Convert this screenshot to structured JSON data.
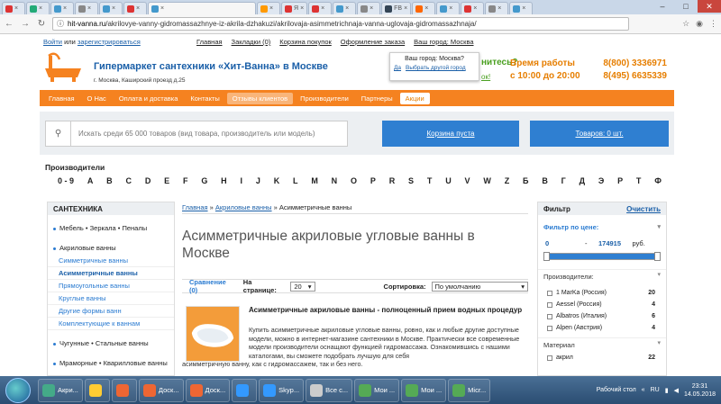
{
  "browser": {
    "tabs": [
      {
        "label": "",
        "color": "#d33"
      },
      {
        "label": "",
        "color": "#2a7"
      },
      {
        "label": "",
        "color": "#49c"
      },
      {
        "label": "",
        "color": "#888"
      },
      {
        "label": "",
        "color": "#49c"
      },
      {
        "label": "",
        "color": "#d33"
      },
      {
        "label": "",
        "color": "#49c"
      },
      {
        "label": "",
        "color": "#f90"
      },
      {
        "label": "Я",
        "color": "#d33"
      },
      {
        "label": "",
        "color": "#d33"
      },
      {
        "label": "",
        "color": "#49c"
      },
      {
        "label": "",
        "color": "#888"
      },
      {
        "label": "FB",
        "color": "#345"
      },
      {
        "label": "",
        "color": "#f60"
      },
      {
        "label": "",
        "color": "#49c"
      },
      {
        "label": "",
        "color": "#d33"
      },
      {
        "label": "",
        "color": "#888"
      },
      {
        "label": "",
        "color": "#49c"
      }
    ],
    "url_host": "hit-vanna.ru",
    "url_path": "/akrilovye-vanny-gidromassazhnye-iz-akrila-dzhakuzi/akrilovaja-asimmetrichnaja-vanna-uglovaja-gidromassazhnaja/"
  },
  "topline": {
    "login": "Войти",
    "or": " или ",
    "register": "зарегистрироваться",
    "links": [
      "Главная",
      "Закладки (0)",
      "Корзина покупок",
      "Оформление заказа",
      "Ваш город: Москва"
    ]
  },
  "header": {
    "site_name": "Гипермаркет сантехники «Хит-Ванна» в Москве",
    "address": "г. Москва, Каширский проезд д.25",
    "city_question": "Ваш город: Москва?",
    "city_yes": "Да",
    "city_other": "Выбрать другой город",
    "green_frag1": "нитесь?",
    "green_frag2": "ок!",
    "hours_title": "Время работы",
    "hours_value": "с 10:00 до 20:00",
    "phone1": "8(800) 3336971",
    "phone2": "8(495) 6635339"
  },
  "nav": [
    "Главная",
    "О Нас",
    "Оплата и доставка",
    "Контакты",
    "Отзывы клиентов",
    "Производители",
    "Партнеры",
    "Акции"
  ],
  "search": {
    "placeholder": "Искать среди 65 000 товаров (вид товара, производитель или модель)",
    "cart": "Корзина пуста",
    "goods": "Товаров: 0 шт."
  },
  "manufacturers_title": "Производители",
  "alphabet": [
    "0 - 9",
    "A",
    "B",
    "C",
    "D",
    "E",
    "F",
    "G",
    "H",
    "I",
    "J",
    "K",
    "L",
    "M",
    "N",
    "O",
    "P",
    "R",
    "S",
    "T",
    "U",
    "V",
    "W",
    "Z",
    "Б",
    "В",
    "Г",
    "Д",
    "Э",
    "Р",
    "Т",
    "Ф"
  ],
  "sidebar": {
    "title": "САНТЕХНИКА",
    "items": [
      {
        "label": "Мебель • Зеркала • Пеналы",
        "type": "top"
      },
      {
        "label": "Акриловые ванны",
        "type": "top"
      },
      {
        "label": "Симметричные ванны",
        "type": "sub"
      },
      {
        "label": "Асимметричные ванны",
        "type": "sub-active"
      },
      {
        "label": "Прямоугольные ванны",
        "type": "sub"
      },
      {
        "label": "Круглые ванны",
        "type": "sub"
      },
      {
        "label": "Другие формы ванн",
        "type": "sub"
      },
      {
        "label": "Комплектующие к ваннам",
        "type": "sub"
      },
      {
        "label": "Чугунные • Стальные ванны",
        "type": "top"
      },
      {
        "label": "Мраморные • Кварилловые ванны",
        "type": "top"
      }
    ]
  },
  "main": {
    "breadcrumb_home": "Главная",
    "breadcrumb_sep1": " » ",
    "breadcrumb_cat": "Акриловые ванны",
    "breadcrumb_sep2": " » ",
    "breadcrumb_current": "Асимметричные ванны",
    "title": "Асимметричные акриловые угловые ванны в Москве",
    "compare": "Сравнение (0)",
    "per_page_label": "На странице:",
    "per_page_value": "20",
    "sort_label": "Сортировка:",
    "sort_value": "По умолчанию",
    "promo_title": "Асимметричные акриловые ванны - полноценный прием водных процедур",
    "promo_text": "Купить асимметричные акриловые угловые ванны, ровно, как и любые другие доступные модели, можно в интернет-магазине сантехники в Москве. Практически все современные модели производители оснащают функцией гидромассажа. Ознакомившись с нашими каталогами, вы сможете подобрать лучшую для себя",
    "promo_text2": "асимметричную ванну, как с гидромассажем, так и без него."
  },
  "filter": {
    "title": "Фильтр",
    "clear": "Очистить",
    "price_label": "Фильтр по цене:",
    "price_min": "0",
    "price_dash": "-",
    "price_max": "174915",
    "currency": "руб.",
    "manufacturers_label": "Производители:",
    "brands": [
      {
        "name": "1 MarKa (Россия)",
        "count": "20"
      },
      {
        "name": "Aessel (Россия)",
        "count": "4"
      },
      {
        "name": "Albatros (Италия)",
        "count": "6"
      },
      {
        "name": "Alpen (Австрия)",
        "count": "4"
      }
    ],
    "material_label": "Материал",
    "material_first": "акрил",
    "material_first_count": "22"
  },
  "taskbar": {
    "items": [
      {
        "label": "Акри...",
        "color": "#4a8"
      },
      {
        "label": "",
        "color": "#fc3"
      },
      {
        "label": "",
        "color": "#e63"
      },
      {
        "label": "Доск...",
        "color": "#e63"
      },
      {
        "label": "Доск...",
        "color": "#e63"
      },
      {
        "label": "",
        "color": "#39f"
      },
      {
        "label": "Skyp...",
        "color": "#39f"
      },
      {
        "label": "Все с...",
        "color": "#ccc"
      },
      {
        "label": "Мои ...",
        "color": "#5a5"
      },
      {
        "label": "Мои ...",
        "color": "#5a5"
      },
      {
        "label": "Micr...",
        "color": "#5a5"
      }
    ],
    "desktop": "Рабочий стол",
    "lang": "RU",
    "time": "23:31",
    "date": "14.05.2018"
  }
}
